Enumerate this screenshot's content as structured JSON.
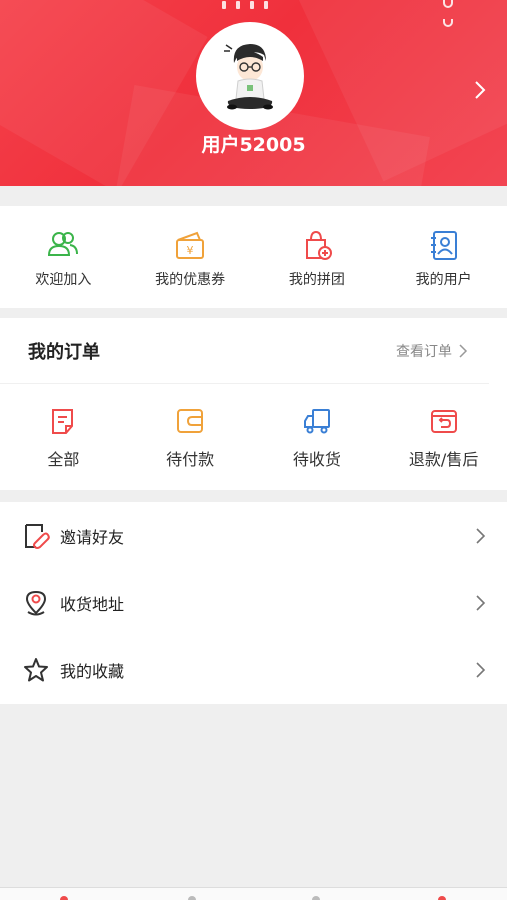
{
  "profile": {
    "username": "用户52005"
  },
  "quick_actions": [
    {
      "label": "欢迎加入",
      "icon": "users-icon",
      "color": "#3bb44a"
    },
    {
      "label": "我的优惠券",
      "icon": "coupon-wallet-icon",
      "color": "#f0a23a"
    },
    {
      "label": "我的拼团",
      "icon": "group-bag-icon",
      "color": "#ef4b4b"
    },
    {
      "label": "我的用户",
      "icon": "contacts-book-icon",
      "color": "#3a7fd5"
    }
  ],
  "orders": {
    "title": "我的订单",
    "view_all": "查看订单",
    "items": [
      {
        "label": "全部",
        "icon": "document-icon",
        "color": "#ef4b4b"
      },
      {
        "label": "待付款",
        "icon": "wallet-icon",
        "color": "#f0a23a"
      },
      {
        "label": "待收货",
        "icon": "truck-icon",
        "color": "#3a7fd5"
      },
      {
        "label": "退款/售后",
        "icon": "refund-icon",
        "color": "#ef4b4b"
      }
    ]
  },
  "menu": [
    {
      "label": "邀请好友",
      "icon": "invite-link-icon"
    },
    {
      "label": "收货地址",
      "icon": "location-pin-icon"
    },
    {
      "label": "我的收藏",
      "icon": "star-icon"
    }
  ],
  "colors": {
    "brand_red": "#f0303c",
    "background": "#efefef"
  }
}
